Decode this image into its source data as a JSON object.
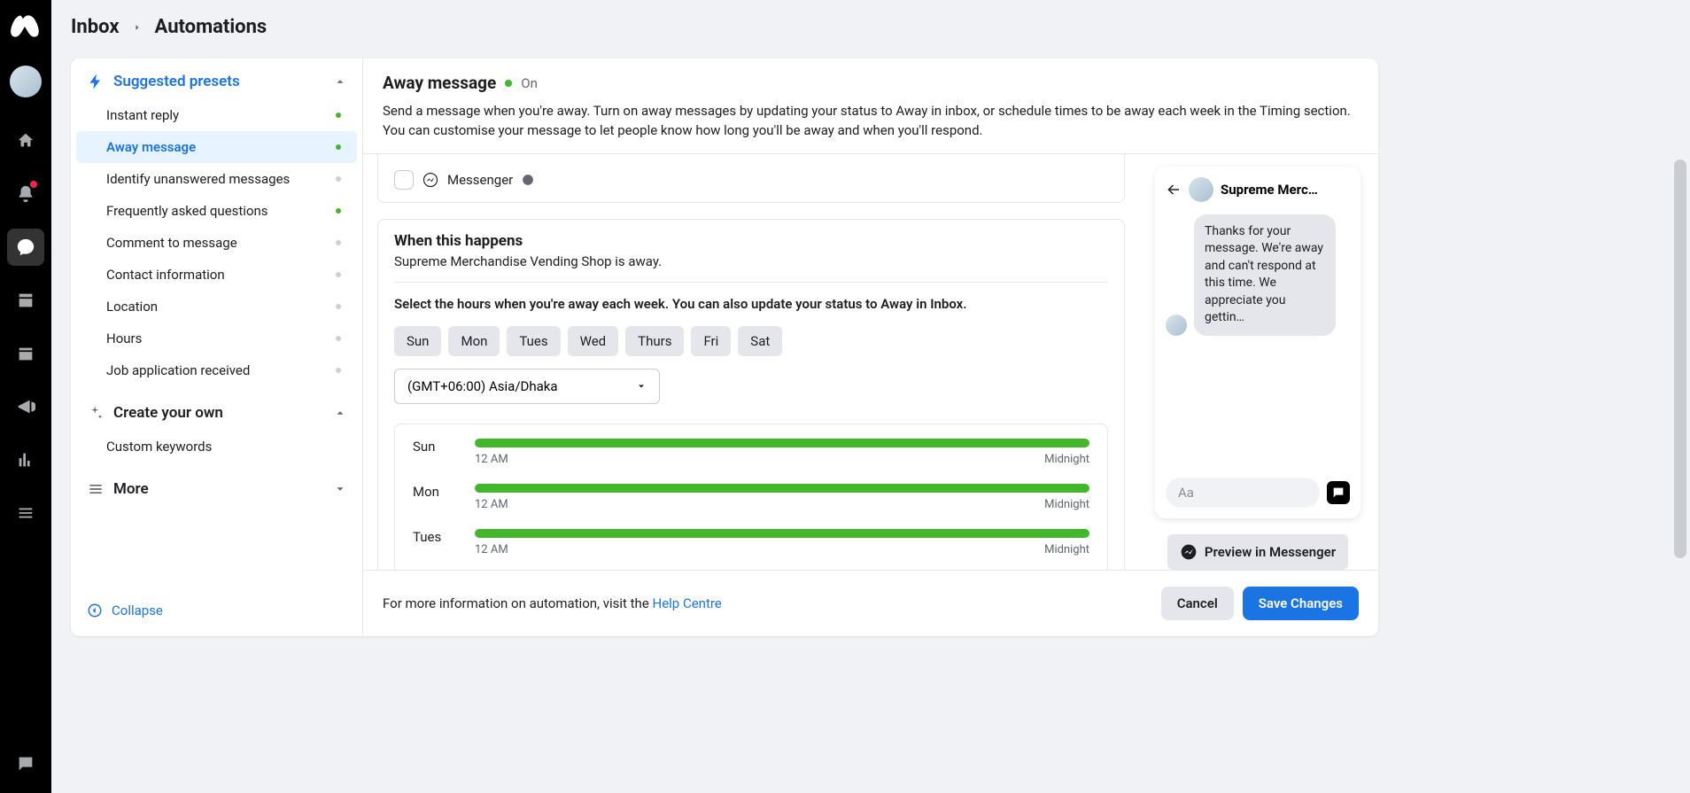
{
  "breadcrumb": {
    "inbox": "Inbox",
    "automations": "Automations"
  },
  "sidebar": {
    "suggested_title": "Suggested presets",
    "presets": [
      {
        "label": "Instant reply",
        "active": true
      },
      {
        "label": "Away message",
        "active": true,
        "selected": true
      },
      {
        "label": "Identify unanswered messages",
        "active": false
      },
      {
        "label": "Frequently asked questions",
        "active": true
      },
      {
        "label": "Comment to message",
        "active": false
      },
      {
        "label": "Contact information",
        "active": false
      },
      {
        "label": "Location",
        "active": false
      },
      {
        "label": "Hours",
        "active": false
      },
      {
        "label": "Job application received",
        "active": false
      }
    ],
    "create_title": "Create your own",
    "create_items": [
      {
        "label": "Custom keywords"
      }
    ],
    "more_title": "More",
    "collapse": "Collapse"
  },
  "header": {
    "title": "Away message",
    "status": "On",
    "desc": "Send a message when you're away. Turn on away messages by updating your status to Away in inbox, or schedule times to be away each week in the Timing section. You can customise your message to let people know how long you'll be away and when you'll respond."
  },
  "editor": {
    "messenger_label": "Messenger",
    "happens_title": "When this happens",
    "happens_sub": "Supreme Merchandise Vending Shop is away.",
    "instruct": "Select the hours when you're away each week. You can also update your status to Away in Inbox.",
    "days": [
      "Sun",
      "Mon",
      "Tues",
      "Wed",
      "Thurs",
      "Fri",
      "Sat"
    ],
    "timezone": "(GMT+06:00) Asia/Dhaka",
    "schedule": [
      {
        "day": "Sun",
        "start": "12 AM",
        "end": "Midnight"
      },
      {
        "day": "Mon",
        "start": "12 AM",
        "end": "Midnight"
      },
      {
        "day": "Tues",
        "start": "12 AM",
        "end": "Midnight"
      }
    ]
  },
  "preview": {
    "page_name": "Supreme Merc…",
    "bubble": "Thanks for your message. We're away and can't respond at this time. We appreciate you gettin…",
    "composer_placeholder": "Aa",
    "preview_btn": "Preview in Messenger"
  },
  "footer": {
    "info_pre": "For more information on automation, visit the ",
    "help_link": "Help Centre",
    "cancel": "Cancel",
    "save": "Save Changes"
  }
}
